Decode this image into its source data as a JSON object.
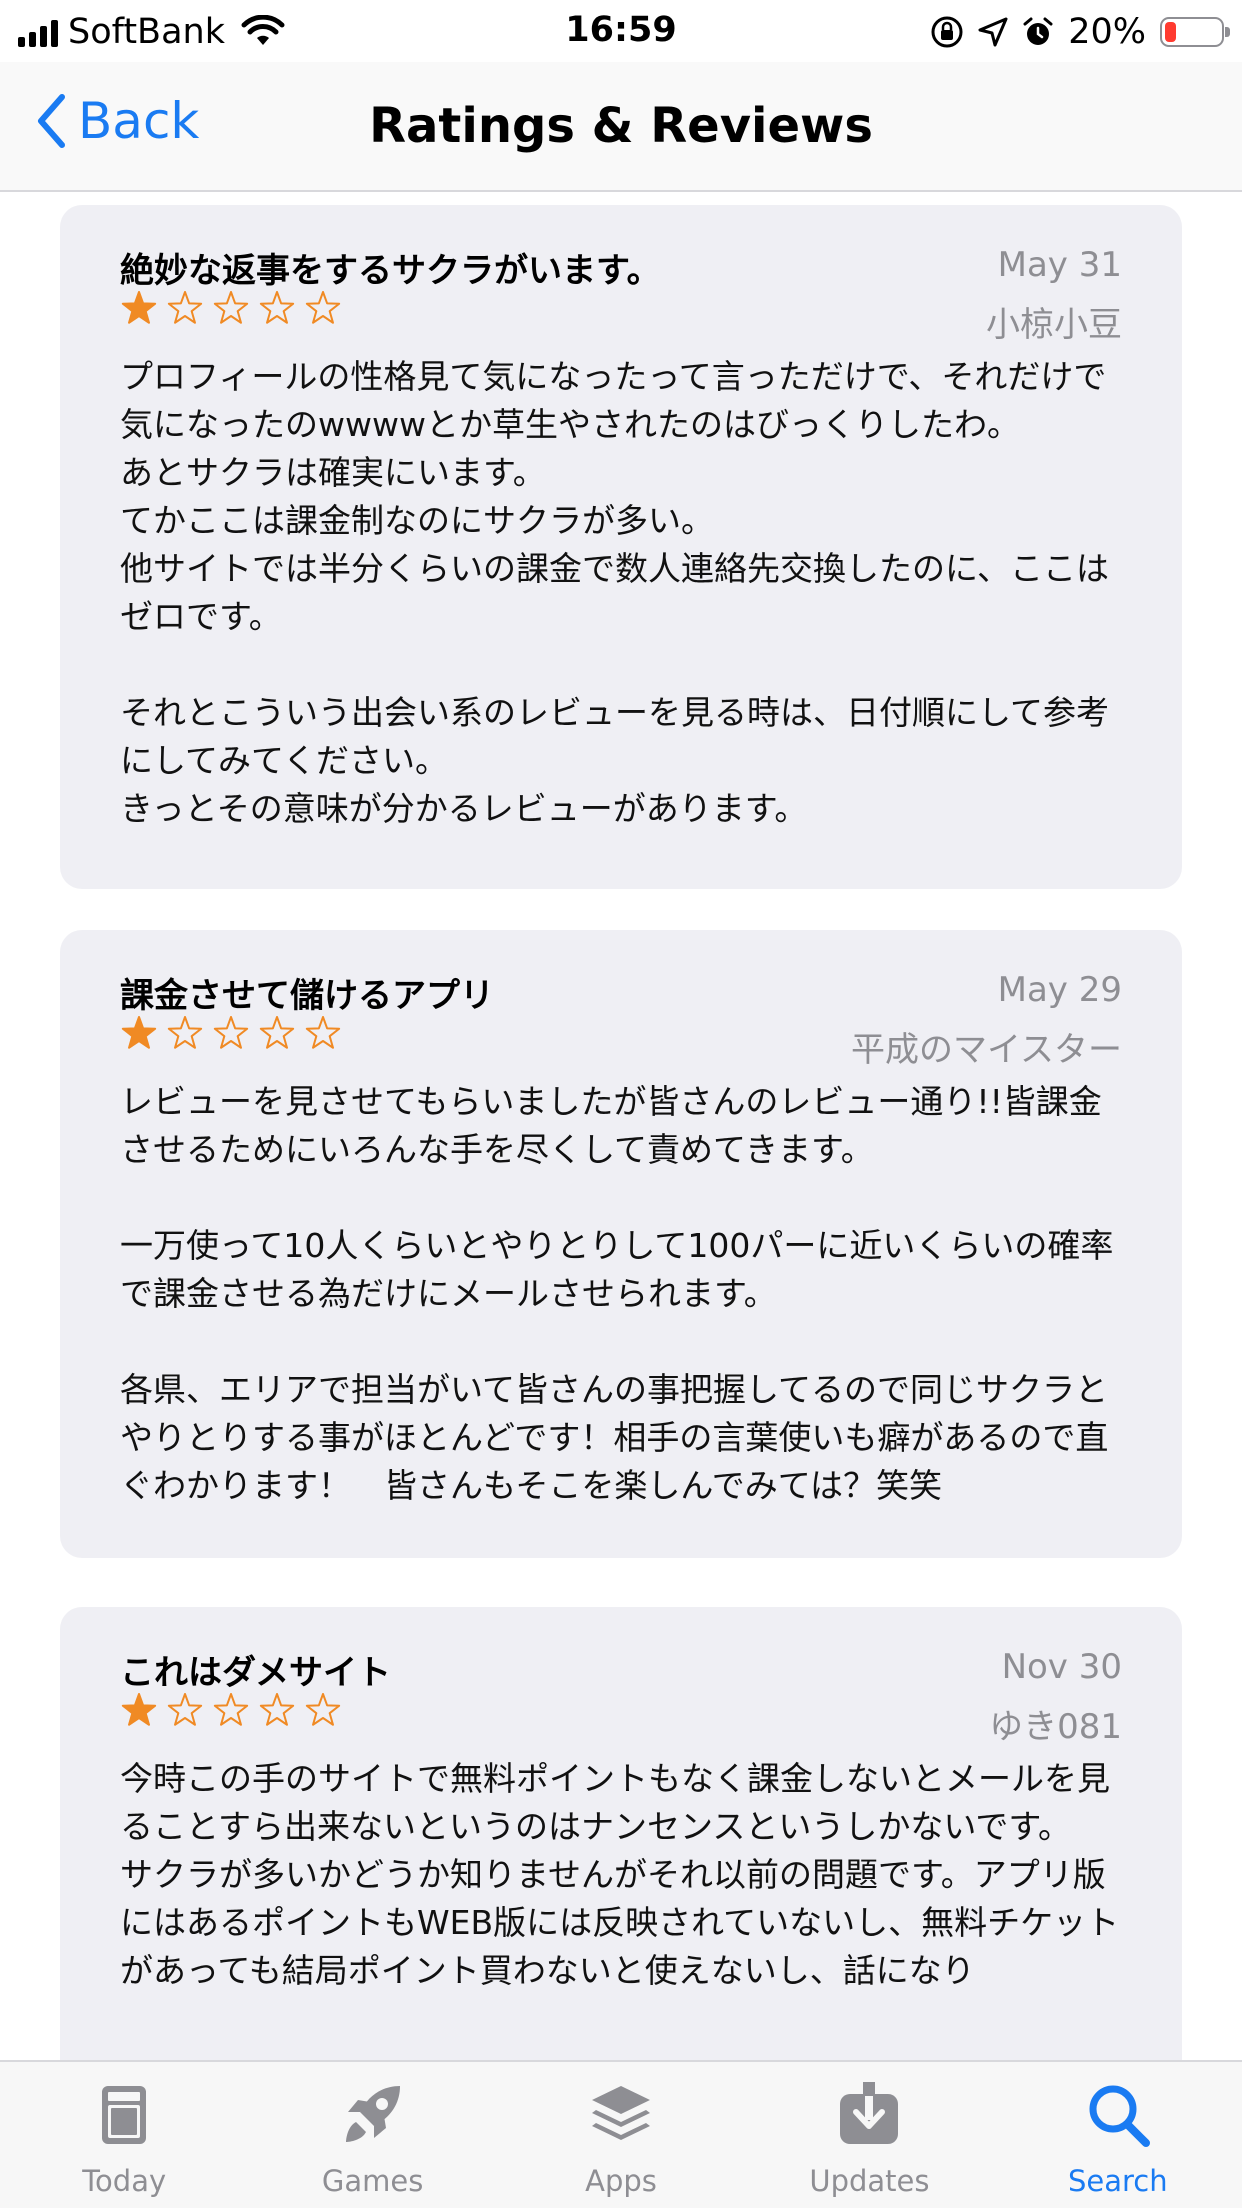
{
  "status_bar": {
    "carrier": "SoftBank",
    "time": "16:59",
    "battery_percent": "20%",
    "battery_level": 0.2,
    "battery_color": "#ff3b30"
  },
  "nav": {
    "back_label": "Back",
    "title": "Ratings & Reviews",
    "accent_color": "#1a7bf2"
  },
  "reviews": [
    {
      "title": "絶妙な返事をするサクラがいます。",
      "date": "May 31",
      "author": "小椋小豆",
      "rating": 1,
      "max_rating": 5,
      "body": "プロフィールの性格見て気になったって言っただけで、それだけで気になったのwwwwとか草生やされたのはびっくりしたわ。\nあとサクラは確実にいます。\nてかここは課金制なのにサクラが多い。\n他サイトでは半分くらいの課金で数人連絡先交換したのに、ここはゼロです。\n\nそれとこういう出会い系のレビューを見る時は、日付順にして参考にしてみてください。\nきっとその意味が分かるレビューがあります。"
    },
    {
      "title": "課金させて儲けるアプリ",
      "date": "May 29",
      "author": "平成のマイスター",
      "rating": 1,
      "max_rating": 5,
      "body": "レビューを見させてもらいましたが皆さんのレビュー通り!!皆課金させるためにいろんな手を尽くして責めてきます。\n\n一万使って10人くらいとやりとりして100パーに近いくらいの確率で課金させる為だけにメールさせられます。\n\n各県、エリアで担当がいて皆さんの事把握してるので同じサクラとやりとりする事がほとんどです！相手の言葉使いも癖があるので直ぐわかります！　皆さんもそこを楽しんでみては？笑笑"
    },
    {
      "title": "これはダメサイト",
      "date": "Nov 30",
      "author": "ゆき081",
      "rating": 1,
      "max_rating": 5,
      "body": "今時この手のサイトで無料ポイントもなく課金しないとメールを見ることすら出来ないというのはナンセンスというしかないです。\nサクラが多いかどうか知りませんがそれ以前の問題です。アプリ版にはあるポイントもWEB版には反映されていないし、無料チケットがあっても結局ポイント買わないと使えないし、話になり"
    }
  ],
  "tabs": [
    {
      "label": "Today",
      "icon": "today-icon",
      "active": false
    },
    {
      "label": "Games",
      "icon": "rocket-icon",
      "active": false
    },
    {
      "label": "Apps",
      "icon": "stack-icon",
      "active": false
    },
    {
      "label": "Updates",
      "icon": "download-icon",
      "active": false
    },
    {
      "label": "Search",
      "icon": "search-icon",
      "active": true
    }
  ],
  "colors": {
    "star": "#f08a24",
    "card_bg": "#efeff4",
    "secondary_text": "#8e8e93",
    "tab_inactive": "#8e8e93",
    "tab_active": "#1a7bf2"
  }
}
